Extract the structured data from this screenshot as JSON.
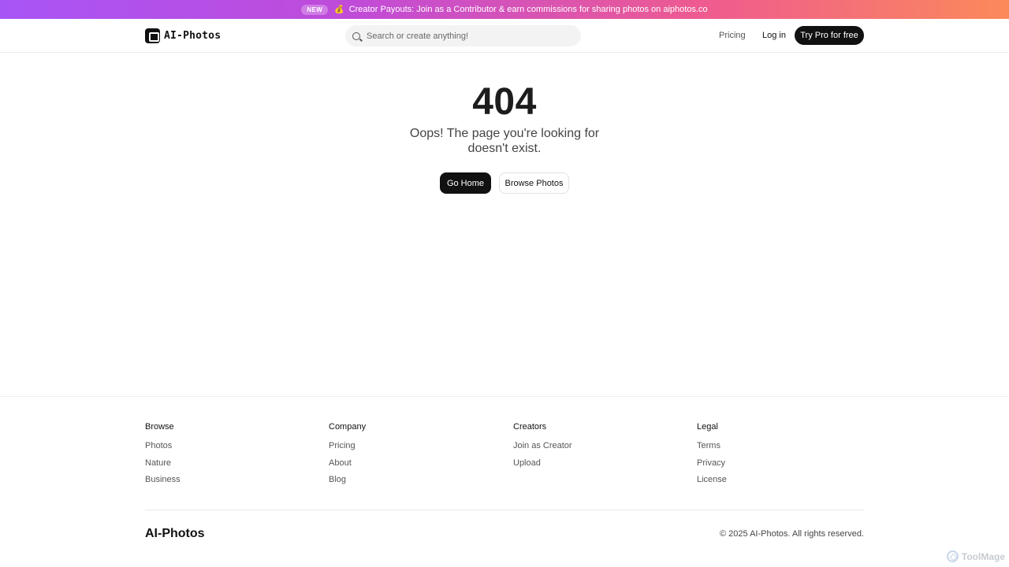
{
  "announcement": {
    "badge": "NEW",
    "icon": "money-bag-icon",
    "icon_glyph": "💰",
    "text": "Creator Payouts: Join as a Contributor & earn commissions for sharing photos on aiphotos.co"
  },
  "header": {
    "logo_text": "AI-Photos",
    "search_placeholder": "Search or create anything!",
    "nav_pricing": "Pricing",
    "nav_login": "Log in",
    "cta": "Try Pro for free"
  },
  "main": {
    "code": "404",
    "message": "Oops! The page you're looking for doesn't exist.",
    "go_home": "Go Home",
    "browse_photos": "Browse Photos"
  },
  "footer": {
    "columns": [
      {
        "heading": "Browse",
        "links": [
          "Photos",
          "Nature",
          "Business"
        ]
      },
      {
        "heading": "Company",
        "links": [
          "Pricing",
          "About",
          "Blog"
        ]
      },
      {
        "heading": "Creators",
        "links": [
          "Join as Creator",
          "Upload"
        ]
      },
      {
        "heading": "Legal",
        "links": [
          "Terms",
          "Privacy",
          "License"
        ]
      }
    ],
    "brand": "AI-Photos",
    "copyright": "© 2025 AI-Photos. All rights reserved."
  },
  "watermark": {
    "text": "ToolMage"
  },
  "colors": {
    "accent": "#111111",
    "banner_start": "#a855f7",
    "banner_end": "#fb8a5a"
  }
}
